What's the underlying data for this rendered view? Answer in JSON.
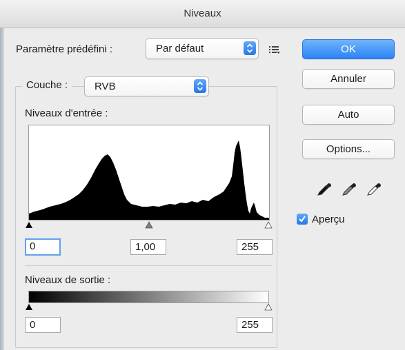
{
  "window": {
    "title": "Niveaux"
  },
  "preset": {
    "label": "Paramètre prédéfini :",
    "value": "Par défaut",
    "menu_icon": "list-menu-icon"
  },
  "channel": {
    "label": "Couche :",
    "value": "RVB"
  },
  "buttons": {
    "ok": "OK",
    "cancel": "Annuler",
    "auto": "Auto",
    "options": "Options..."
  },
  "input_levels": {
    "label": "Niveaux d'entrée :",
    "black": "0",
    "gamma": "1,00",
    "white": "255"
  },
  "output_levels": {
    "label": "Niveaux de sortie :",
    "black": "0",
    "white": "255"
  },
  "preview": {
    "label": "Aperçu",
    "checked": true
  },
  "eyedroppers": [
    "black-point-eyedropper-icon",
    "gray-point-eyedropper-icon",
    "white-point-eyedropper-icon"
  ],
  "colors": {
    "accent": "#2b83f6",
    "focus": "#62a0ec"
  }
}
